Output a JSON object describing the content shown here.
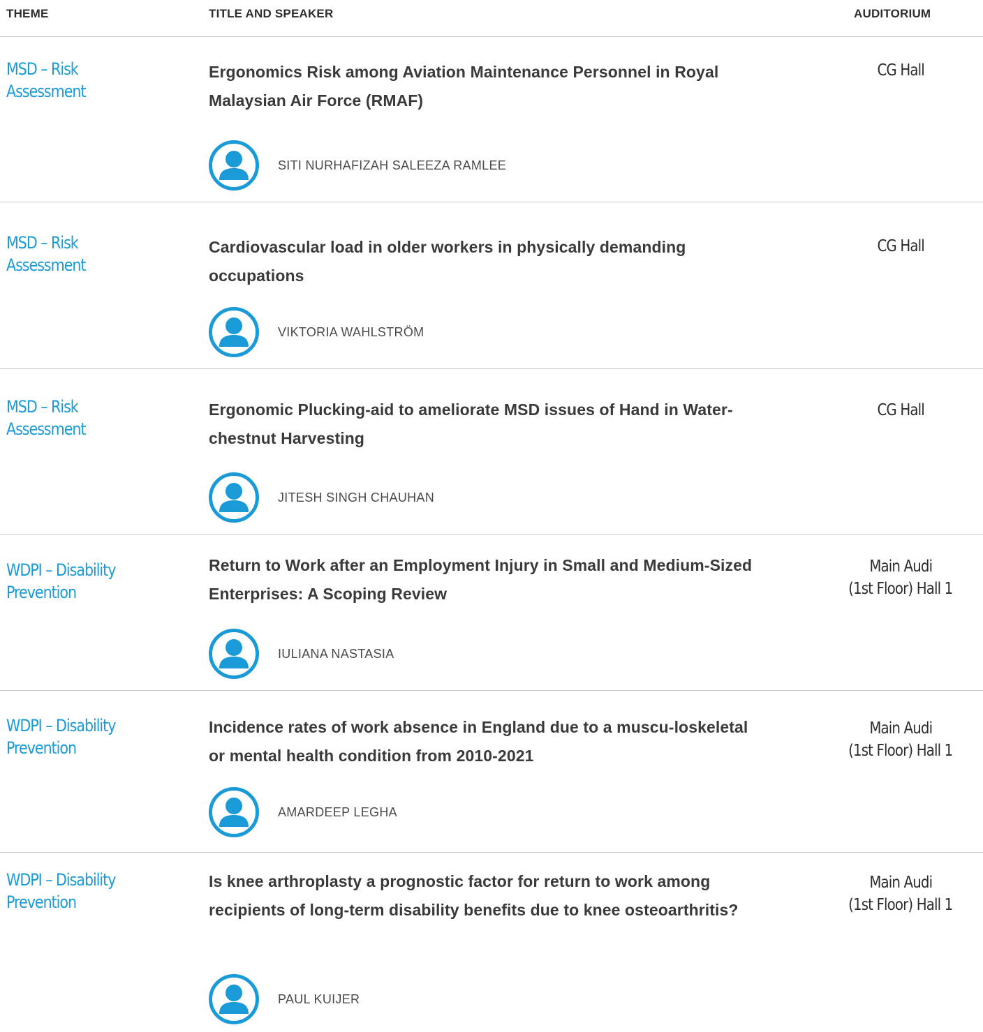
{
  "header": {
    "theme": "THEME",
    "title_speaker": "TITLE AND SPEAKER",
    "auditorium": "AUDITORIUM"
  },
  "sessions": [
    {
      "theme": "MSD – Risk Assessment",
      "title": "Ergonomics Risk among Aviation Maintenance Personnel in Royal Malaysian Air  Force (RMAF)",
      "speaker": "SITI NURHAFIZAH SALEEZA RAMLEE",
      "auditorium_line1": "CG Hall",
      "auditorium_line2": ""
    },
    {
      "theme": "MSD – Risk Assessment",
      "title": "Cardiovascular load in older workers in physically demanding occupations",
      "speaker": "VIKTORIA WAHLSTRÖM",
      "auditorium_line1": "CG Hall",
      "auditorium_line2": ""
    },
    {
      "theme": "MSD – Risk Assessment",
      "title": "Ergonomic Plucking-aid to ameliorate MSD issues of Hand in Water-chestnut Harvesting",
      "speaker": "JITESH SINGH CHAUHAN",
      "auditorium_line1": "CG Hall",
      "auditorium_line2": ""
    },
    {
      "theme": "WDPI – Disability Prevention",
      "title": "Return to Work after an Employment Injury in Small and Medium-Sized Enterprises: A Scoping Review",
      "speaker": "IULIANA NASTASIA",
      "auditorium_line1": "Main Audi",
      "auditorium_line2": "(1st Floor) Hall 1"
    },
    {
      "theme": "WDPI – Disability Prevention",
      "title": "Incidence rates of work absence in England due to a muscu-loskeletal or mental health condition from 2010-2021",
      "speaker": "AMARDEEP LEGHA",
      "auditorium_line1": "Main Audi",
      "auditorium_line2": "(1st Floor) Hall 1"
    },
    {
      "theme": "WDPI – Disability Prevention",
      "title": "Is knee arthroplasty a prognostic factor for return to work among recipients of long-term disability benefits due to knee osteoarthritis?",
      "speaker": "PAUL KUIJER",
      "auditorium_line1": "Main Audi",
      "auditorium_line2": "(1st Floor) Hall 1"
    }
  ],
  "icons": {
    "avatar": "user-avatar-icon"
  },
  "colors": {
    "theme_link": "#1a9ad6",
    "avatar": "#1a9ad6",
    "title_text": "#3a3a3a",
    "divider": "#c9c9c9"
  }
}
